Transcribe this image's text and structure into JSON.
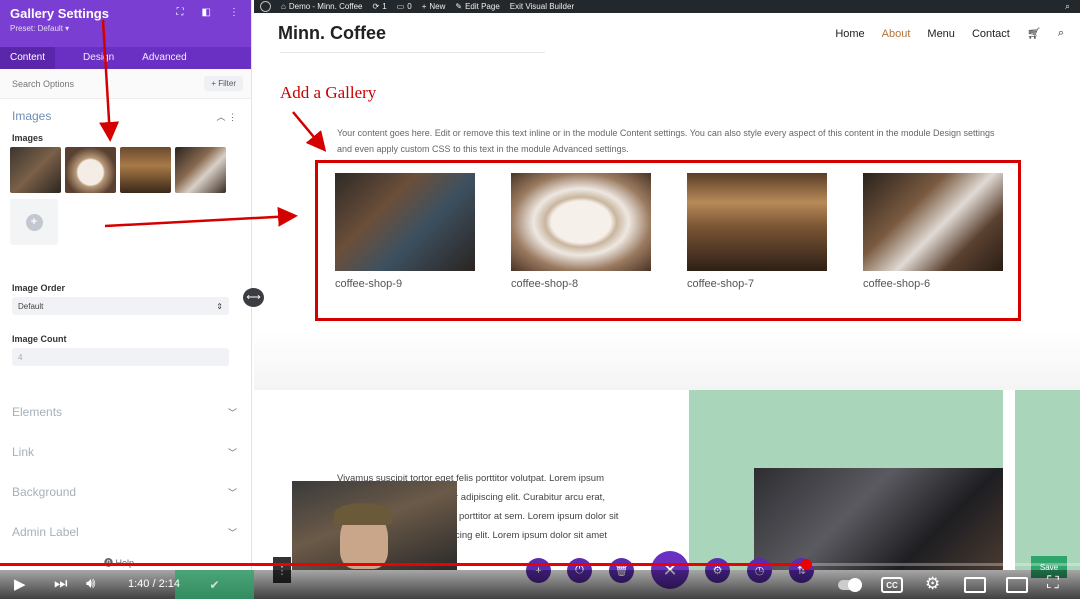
{
  "adminbar": {
    "site_name": "Demo - Minn. Coffee",
    "comments_count": "1",
    "bubble_count": "0",
    "new_label": "New",
    "edit_label": "Edit Page",
    "exit_label": "Exit Visual Builder"
  },
  "panel": {
    "title": "Gallery Settings",
    "preset": "Preset: Default ▾",
    "tabs": [
      "Content",
      "Design",
      "Advanced"
    ],
    "search_placeholder": "Search Options",
    "filter_label": "+ Filter",
    "images_section": "Images",
    "images_field_label": "Images",
    "image_order_label": "Image Order",
    "image_order_value": "Default",
    "image_count_label": "Image Count",
    "image_count_value": "4",
    "collapsed_sections": [
      "Elements",
      "Link",
      "Background",
      "Admin Label"
    ],
    "help_label": "Help"
  },
  "site": {
    "logo": "Minn. Coffee",
    "nav": [
      "Home",
      "About",
      "Menu",
      "Contact"
    ],
    "active_nav": "About"
  },
  "annotation": "Add a Gallery",
  "content_text": "Your content goes here. Edit or remove this text inline or in the module Content settings. You can also style every aspect of this content in the module Design settings and even apply custom CSS to this text in the module Advanced settings.",
  "gallery": [
    {
      "caption": "coffee-shop-9"
    },
    {
      "caption": "coffee-shop-8"
    },
    {
      "caption": "coffee-shop-7"
    },
    {
      "caption": "coffee-shop-6"
    }
  ],
  "lorem_lines": [
    "Vivamus suscipit tortor eget felis porttitor volutpat. Lorem ipsum",
    "r adipiscing elit. Curabitur arcu erat,",
    "porttitor at sem. Lorem ipsum dolor sit",
    "cing elit. Lorem ipsum dolor sit amet"
  ],
  "builder": {
    "save_label": "Save"
  },
  "player": {
    "time": "1:40 / 2:14",
    "progress": 0.7463,
    "cc_label": "CC"
  },
  "colors": {
    "purple_header": "#7b3ed2",
    "annotation_red": "#d40000",
    "accent_nav": "#b4733b",
    "progress_red": "#e00000"
  }
}
